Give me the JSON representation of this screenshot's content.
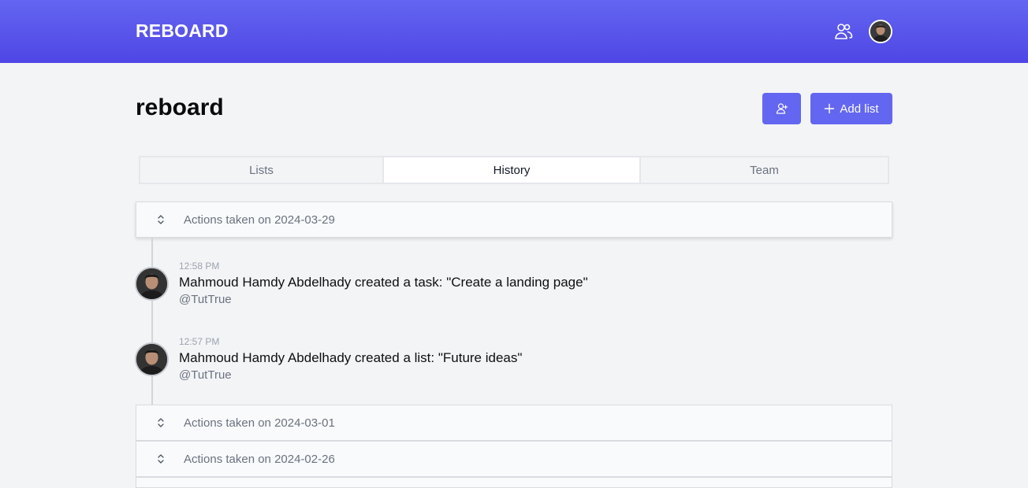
{
  "app": {
    "brand": "REBOARD"
  },
  "header": {
    "team_icon": "users-icon",
    "avatar_icon": "user-avatar"
  },
  "board": {
    "title": "reboard",
    "invite_icon": "user-plus-icon",
    "add_list_label": "Add list",
    "add_list_icon": "plus-icon"
  },
  "tabs": [
    {
      "label": "Lists",
      "active": false
    },
    {
      "label": "History",
      "active": true
    },
    {
      "label": "Team",
      "active": false
    }
  ],
  "history": {
    "groups": [
      {
        "label": "Actions taken on 2024-03-29",
        "expanded": true,
        "entries": [
          {
            "time": "12:58 PM",
            "text": "Mahmoud Hamdy Abdelhady created a task: \"Create a landing page\"",
            "user": "@TutTrue"
          },
          {
            "time": "12:57 PM",
            "text": "Mahmoud Hamdy Abdelhady created a list: \"Future ideas\"",
            "user": "@TutTrue"
          }
        ]
      },
      {
        "label": "Actions taken on 2024-03-01",
        "expanded": false
      },
      {
        "label": "Actions taken on 2024-02-26",
        "expanded": false
      }
    ]
  },
  "colors": {
    "primary": "#6366f1",
    "background": "#f3f4f6"
  }
}
